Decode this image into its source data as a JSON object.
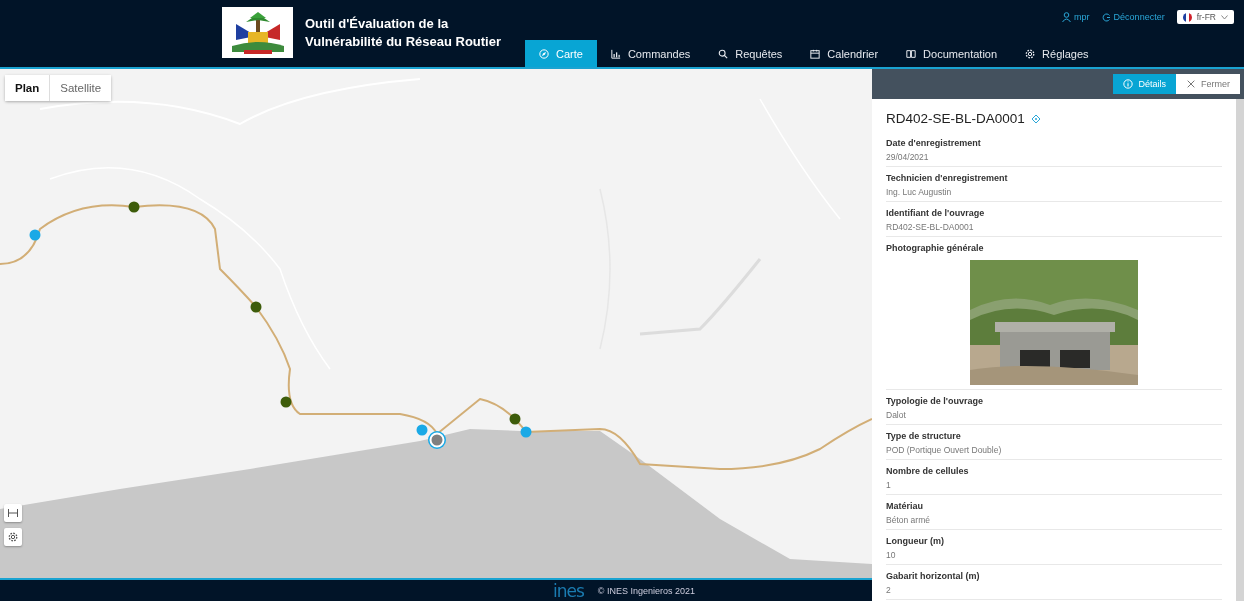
{
  "app": {
    "title": "Outil d'Évaluation de la Vulnérabilité du Réseau Routier"
  },
  "nav": [
    {
      "label": "Carte",
      "kind": "compass",
      "selected": true
    },
    {
      "label": "Commandes",
      "kind": "chart",
      "selected": false
    },
    {
      "label": "Requêtes",
      "kind": "search",
      "selected": false
    },
    {
      "label": "Calendrier",
      "kind": "calendar",
      "selected": false
    },
    {
      "label": "Documentation",
      "kind": "book",
      "selected": false
    },
    {
      "label": "Réglages",
      "kind": "gear",
      "selected": false
    }
  ],
  "user": {
    "name": "mpr",
    "logout": "Déconnecter",
    "language": "fr-FR"
  },
  "map": {
    "map_types": [
      {
        "label": "Plan",
        "selected": true
      },
      {
        "label": "Satellite",
        "selected": false
      }
    ],
    "markers": [
      {
        "color": "#3d5c0a",
        "selected": false
      },
      {
        "color": "#1aa9e6",
        "selected": false
      },
      {
        "color": "#3d5c0a",
        "selected": false
      },
      {
        "color": "#3d5c0a",
        "selected": false
      },
      {
        "color": "#3d5c0a",
        "selected": false
      },
      {
        "color": "#1aa9e6",
        "selected": false
      },
      {
        "color": "#1aa9e6",
        "selected": false
      },
      {
        "color": "#808080",
        "selected": true
      }
    ]
  },
  "panel": {
    "buttons": [
      {
        "label": "Détails",
        "kind": "info",
        "selected": true
      },
      {
        "label": "Fermer",
        "kind": "close",
        "selected": false
      }
    ],
    "title": "RD402-SE-BL-DA0001",
    "fields": [
      {
        "kind": "text",
        "label": "Date d'enregistrement",
        "value": "29/04/2021"
      },
      {
        "kind": "text",
        "label": "Technicien d'enregistrement",
        "value": "Ing. Luc Augustin"
      },
      {
        "kind": "text",
        "label": "Identifiant de l'ouvrage",
        "value": "RD402-SE-BL-DA0001"
      },
      {
        "label": "Photographie générale"
      },
      {
        "kind": "text",
        "label": "Typologie de l'ouvrage",
        "value": "Dalot"
      },
      {
        "kind": "text",
        "label": "Type de structure",
        "value": "POD (Portique Ouvert Double)"
      },
      {
        "kind": "text",
        "label": "Nombre de cellules",
        "value": "1"
      },
      {
        "kind": "text",
        "label": "Matériau",
        "value": "Béton armé"
      },
      {
        "kind": "text",
        "label": "Longueur (m)",
        "value": "10"
      },
      {
        "kind": "text",
        "label": "Gabarit horizontal (m)",
        "value": "2"
      }
    ]
  },
  "footer": {
    "logo": "ines",
    "copyright": "© INES Ingenieros 2021"
  }
}
